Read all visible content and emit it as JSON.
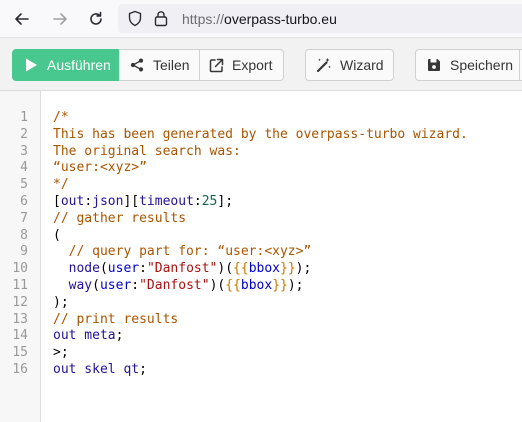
{
  "browser": {
    "url_scheme": "https://",
    "url_host": "overpass-turbo.eu"
  },
  "toolbar": {
    "run_label": "Ausführen",
    "share_label": "Teilen",
    "export_label": "Export",
    "wizard_label": "Wizard",
    "save_label": "Speichern"
  },
  "editor": {
    "lines": [
      {
        "n": "1",
        "tokens": [
          {
            "c": "comment",
            "t": "/*"
          }
        ]
      },
      {
        "n": "2",
        "tokens": [
          {
            "c": "comment",
            "t": "This has been generated by the overpass-turbo wizard."
          }
        ]
      },
      {
        "n": "3",
        "tokens": [
          {
            "c": "comment",
            "t": "The original search was:"
          }
        ]
      },
      {
        "n": "4",
        "tokens": [
          {
            "c": "comment",
            "t": "“user:<xyz>”"
          }
        ]
      },
      {
        "n": "5",
        "tokens": [
          {
            "c": "comment",
            "t": "*/"
          }
        ]
      },
      {
        "n": "6",
        "tokens": [
          {
            "c": "def",
            "t": "["
          },
          {
            "c": "kw",
            "t": "out"
          },
          {
            "c": "def",
            "t": ":"
          },
          {
            "c": "kw",
            "t": "json"
          },
          {
            "c": "def",
            "t": "]["
          },
          {
            "c": "kw",
            "t": "timeout"
          },
          {
            "c": "def",
            "t": ":"
          },
          {
            "c": "num",
            "t": "25"
          },
          {
            "c": "def",
            "t": "];"
          }
        ]
      },
      {
        "n": "7",
        "tokens": [
          {
            "c": "comment",
            "t": "// gather results"
          }
        ]
      },
      {
        "n": "8",
        "tokens": [
          {
            "c": "def",
            "t": "("
          }
        ]
      },
      {
        "n": "9",
        "tokens": [
          {
            "c": "def",
            "t": "  "
          },
          {
            "c": "comment",
            "t": "// query part for: “user:<xyz>”"
          }
        ]
      },
      {
        "n": "10",
        "tokens": [
          {
            "c": "def",
            "t": "  "
          },
          {
            "c": "kw",
            "t": "node"
          },
          {
            "c": "def",
            "t": "("
          },
          {
            "c": "prop",
            "t": "user"
          },
          {
            "c": "def",
            "t": ":"
          },
          {
            "c": "str",
            "t": "\"Danfost\""
          },
          {
            "c": "def",
            "t": ")("
          },
          {
            "c": "tpl",
            "t": "{{"
          },
          {
            "c": "prop",
            "t": "bbox"
          },
          {
            "c": "tpl",
            "t": "}}"
          },
          {
            "c": "def",
            "t": ");"
          }
        ]
      },
      {
        "n": "11",
        "tokens": [
          {
            "c": "def",
            "t": "  "
          },
          {
            "c": "kw",
            "t": "way"
          },
          {
            "c": "def",
            "t": "("
          },
          {
            "c": "prop",
            "t": "user"
          },
          {
            "c": "def",
            "t": ":"
          },
          {
            "c": "str",
            "t": "\"Danfost\""
          },
          {
            "c": "def",
            "t": ")("
          },
          {
            "c": "tpl",
            "t": "{{"
          },
          {
            "c": "prop",
            "t": "bbox"
          },
          {
            "c": "tpl",
            "t": "}}"
          },
          {
            "c": "def",
            "t": ");"
          }
        ]
      },
      {
        "n": "12",
        "tokens": [
          {
            "c": "def",
            "t": ");"
          }
        ]
      },
      {
        "n": "13",
        "tokens": [
          {
            "c": "comment",
            "t": "// print results"
          }
        ]
      },
      {
        "n": "14",
        "tokens": [
          {
            "c": "kw",
            "t": "out meta"
          },
          {
            "c": "def",
            "t": ";"
          }
        ]
      },
      {
        "n": "15",
        "tokens": [
          {
            "c": "def",
            "t": ">;"
          }
        ]
      },
      {
        "n": "16",
        "tokens": [
          {
            "c": "kw",
            "t": "out skel qt"
          },
          {
            "c": "def",
            "t": ";"
          }
        ]
      }
    ]
  }
}
